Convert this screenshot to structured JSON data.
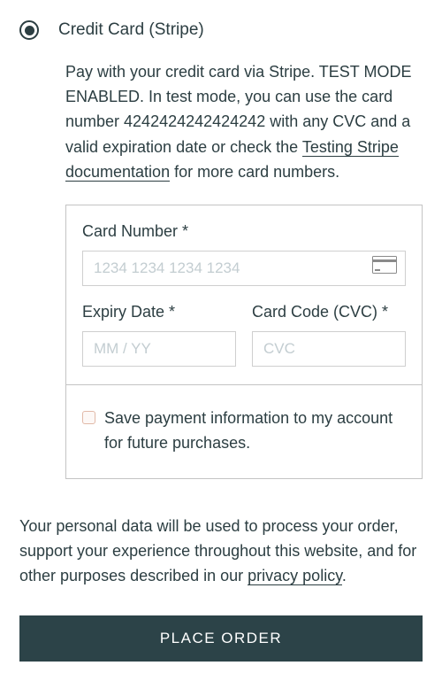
{
  "payment": {
    "radio_label": "Credit Card (Stripe)",
    "description_pre": "Pay with your credit card via Stripe. TEST MODE ENABLED. In test mode, you can use the card number 4242424242424242 with any CVC and a valid expiration date or check the ",
    "doc_link": "Testing Stripe documentation",
    "description_post": " for more card numbers."
  },
  "card": {
    "number_label": "Card Number *",
    "number_placeholder": "1234 1234 1234 1234",
    "expiry_label": "Expiry Date *",
    "expiry_placeholder": "MM / YY",
    "cvc_label": "Card Code (CVC) *",
    "cvc_placeholder": "CVC",
    "save_label": "Save payment information to my account for future purchases."
  },
  "privacy": {
    "pre": "Your personal data will be used to process your order, support your experience throughout this website, and for other purposes described in our ",
    "link": "privacy policy",
    "post": "."
  },
  "button": {
    "place_order": "PLACE ORDER"
  }
}
